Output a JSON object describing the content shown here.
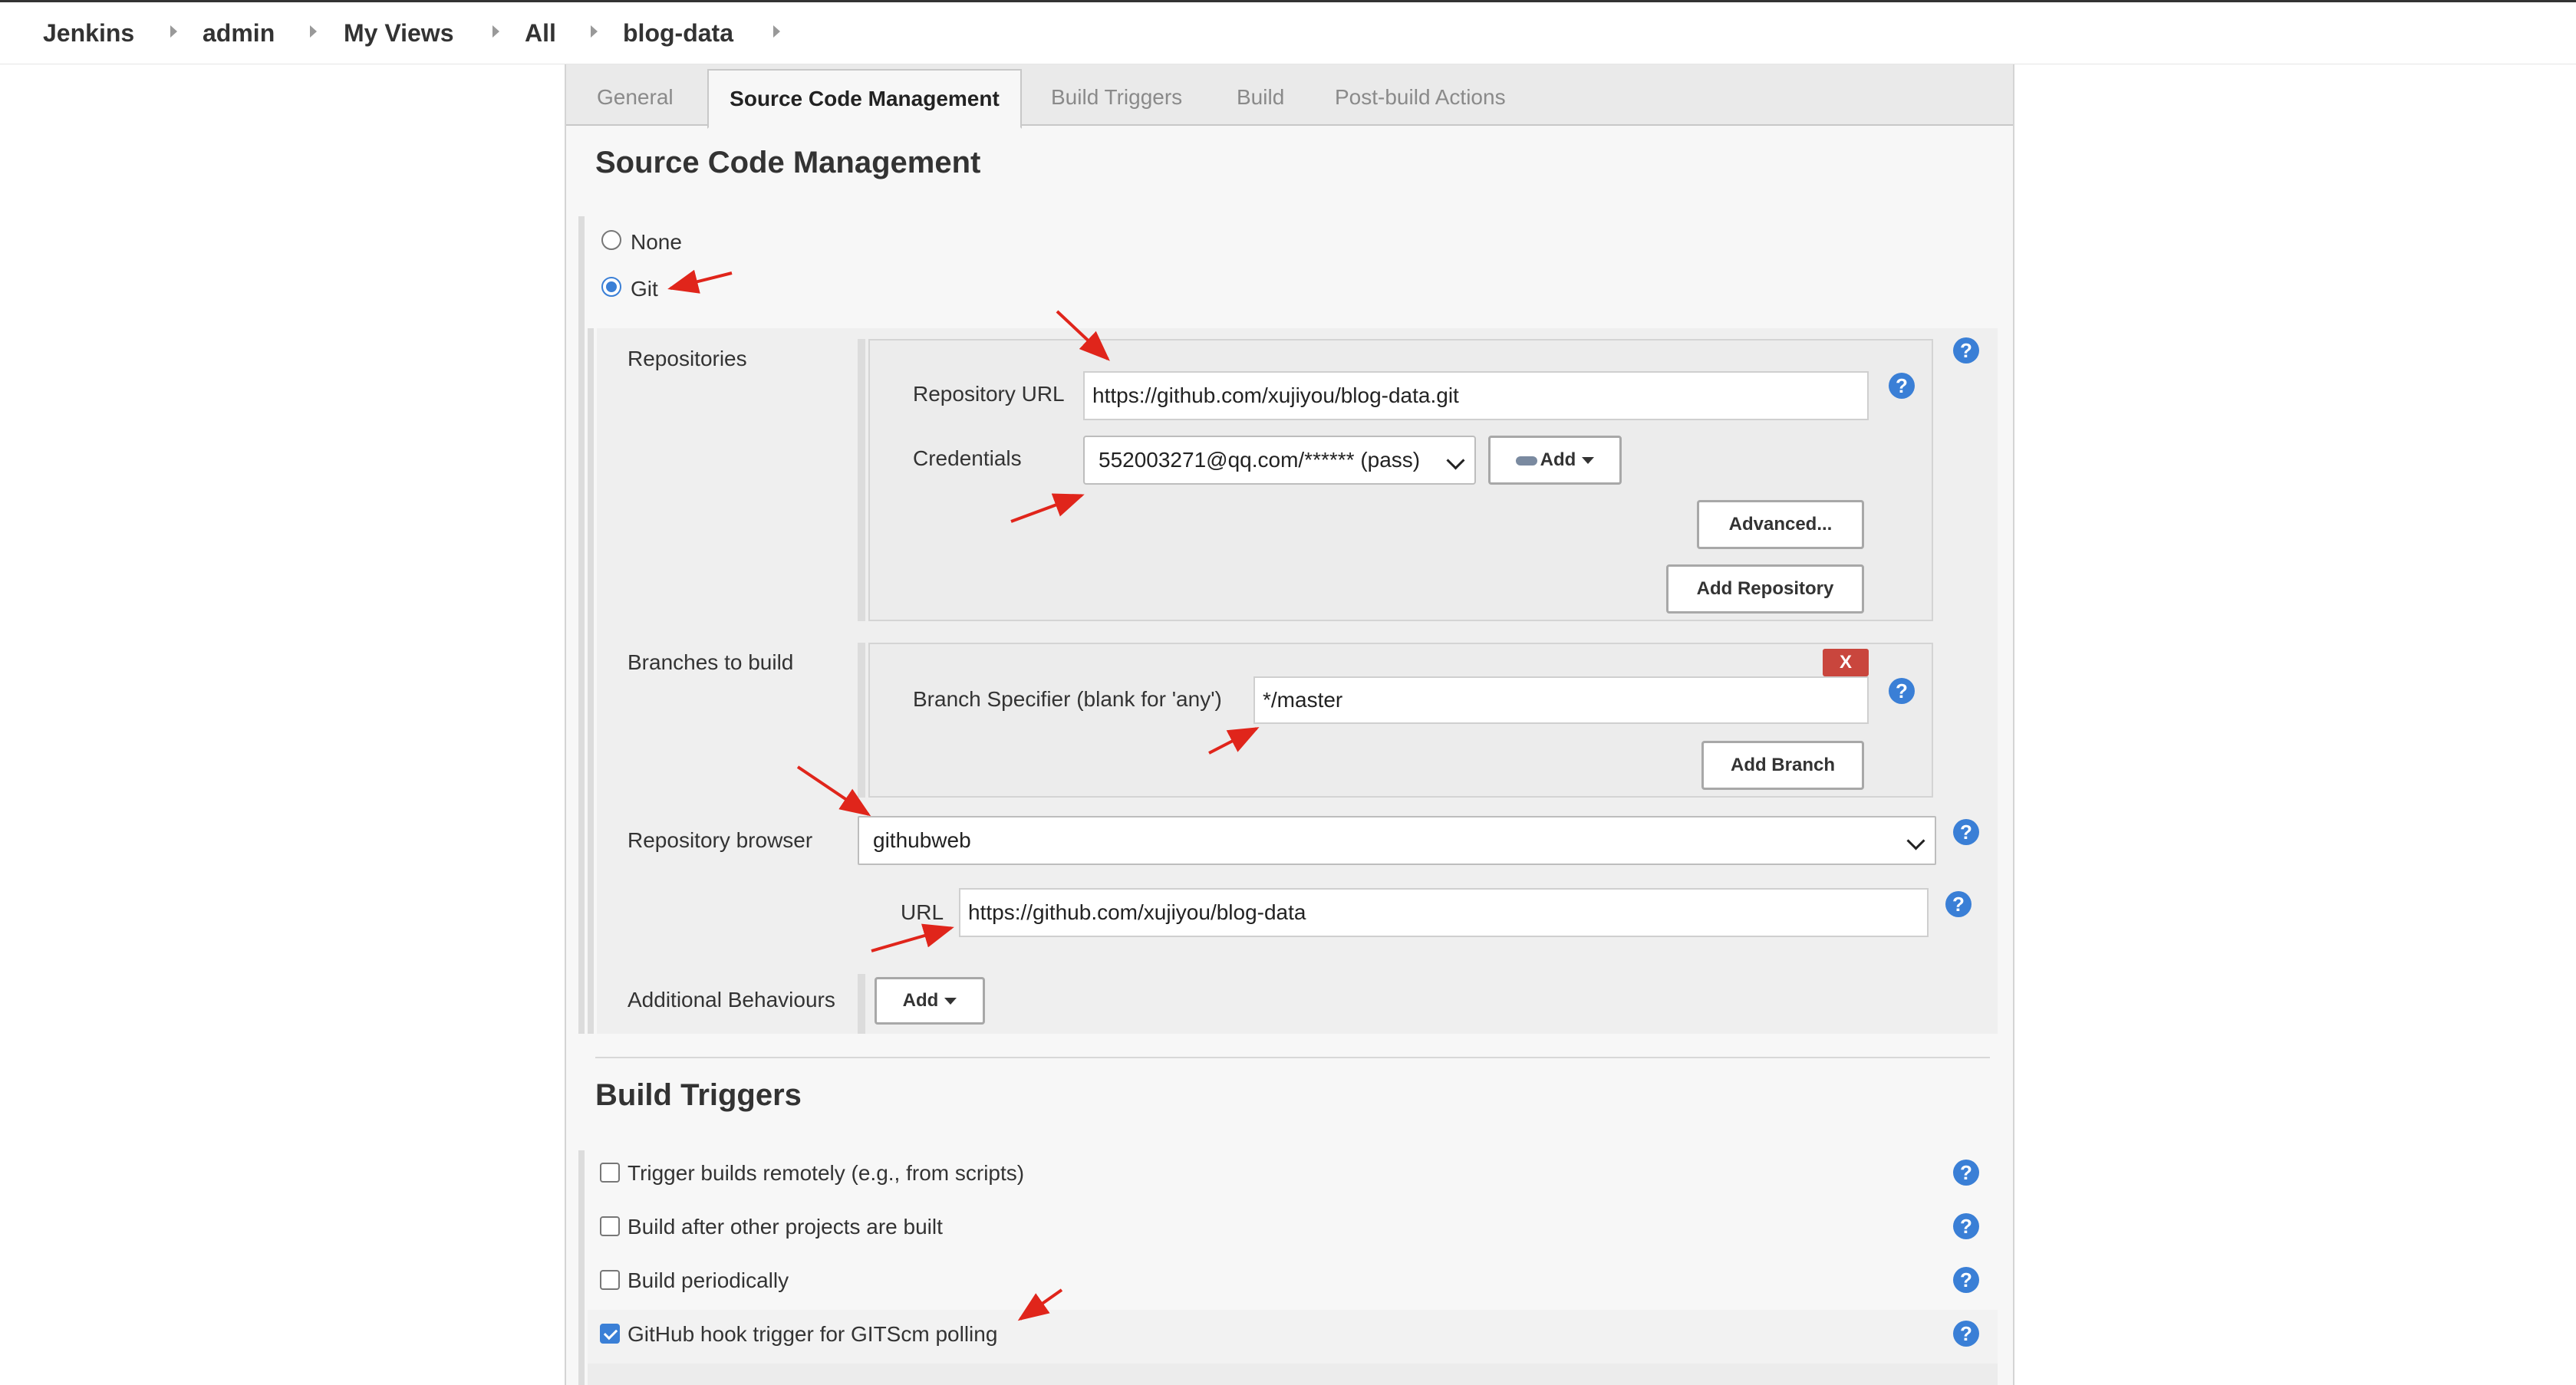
{
  "breadcrumb": [
    "Jenkins",
    "admin",
    "My Views",
    "All",
    "blog-data"
  ],
  "tabs": [
    "General",
    "Source Code Management",
    "Build Triggers",
    "Build",
    "Post-build Actions"
  ],
  "scm": {
    "title": "Source Code Management",
    "options": [
      "None",
      "Git"
    ],
    "selected": "Git",
    "repositories_label": "Repositories",
    "repo_url_label": "Repository URL",
    "repo_url": "https://github.com/xujiyou/blog-data.git",
    "credentials_label": "Credentials",
    "credentials_value": "552003271@qq.com/****** (pass)",
    "add_label": "Add",
    "advanced_label": "Advanced...",
    "add_repository_label": "Add Repository",
    "branches_label": "Branches to build",
    "delete_label": "X",
    "branch_specifier_label": "Branch Specifier (blank for 'any')",
    "branch_specifier": "*/master",
    "add_branch_label": "Add Branch",
    "repo_browser_label": "Repository browser",
    "repo_browser_value": "githubweb",
    "browser_url_label": "URL",
    "browser_url": "https://github.com/xujiyou/blog-data",
    "additional_label": "Additional Behaviours",
    "additional_add_label": "Add"
  },
  "build_triggers": {
    "title": "Build Triggers",
    "items": [
      {
        "label": "Trigger builds remotely (e.g., from scripts)",
        "checked": false
      },
      {
        "label": "Build after other projects are built",
        "checked": false
      },
      {
        "label": "Build periodically",
        "checked": false
      },
      {
        "label": "GitHub hook trigger for GITScm polling",
        "checked": true
      }
    ]
  },
  "help_symbol": "?",
  "colors": {
    "accent": "#3a7fd6",
    "annotation_arrow": "#e0251b",
    "delete_button": "#c9463d"
  }
}
